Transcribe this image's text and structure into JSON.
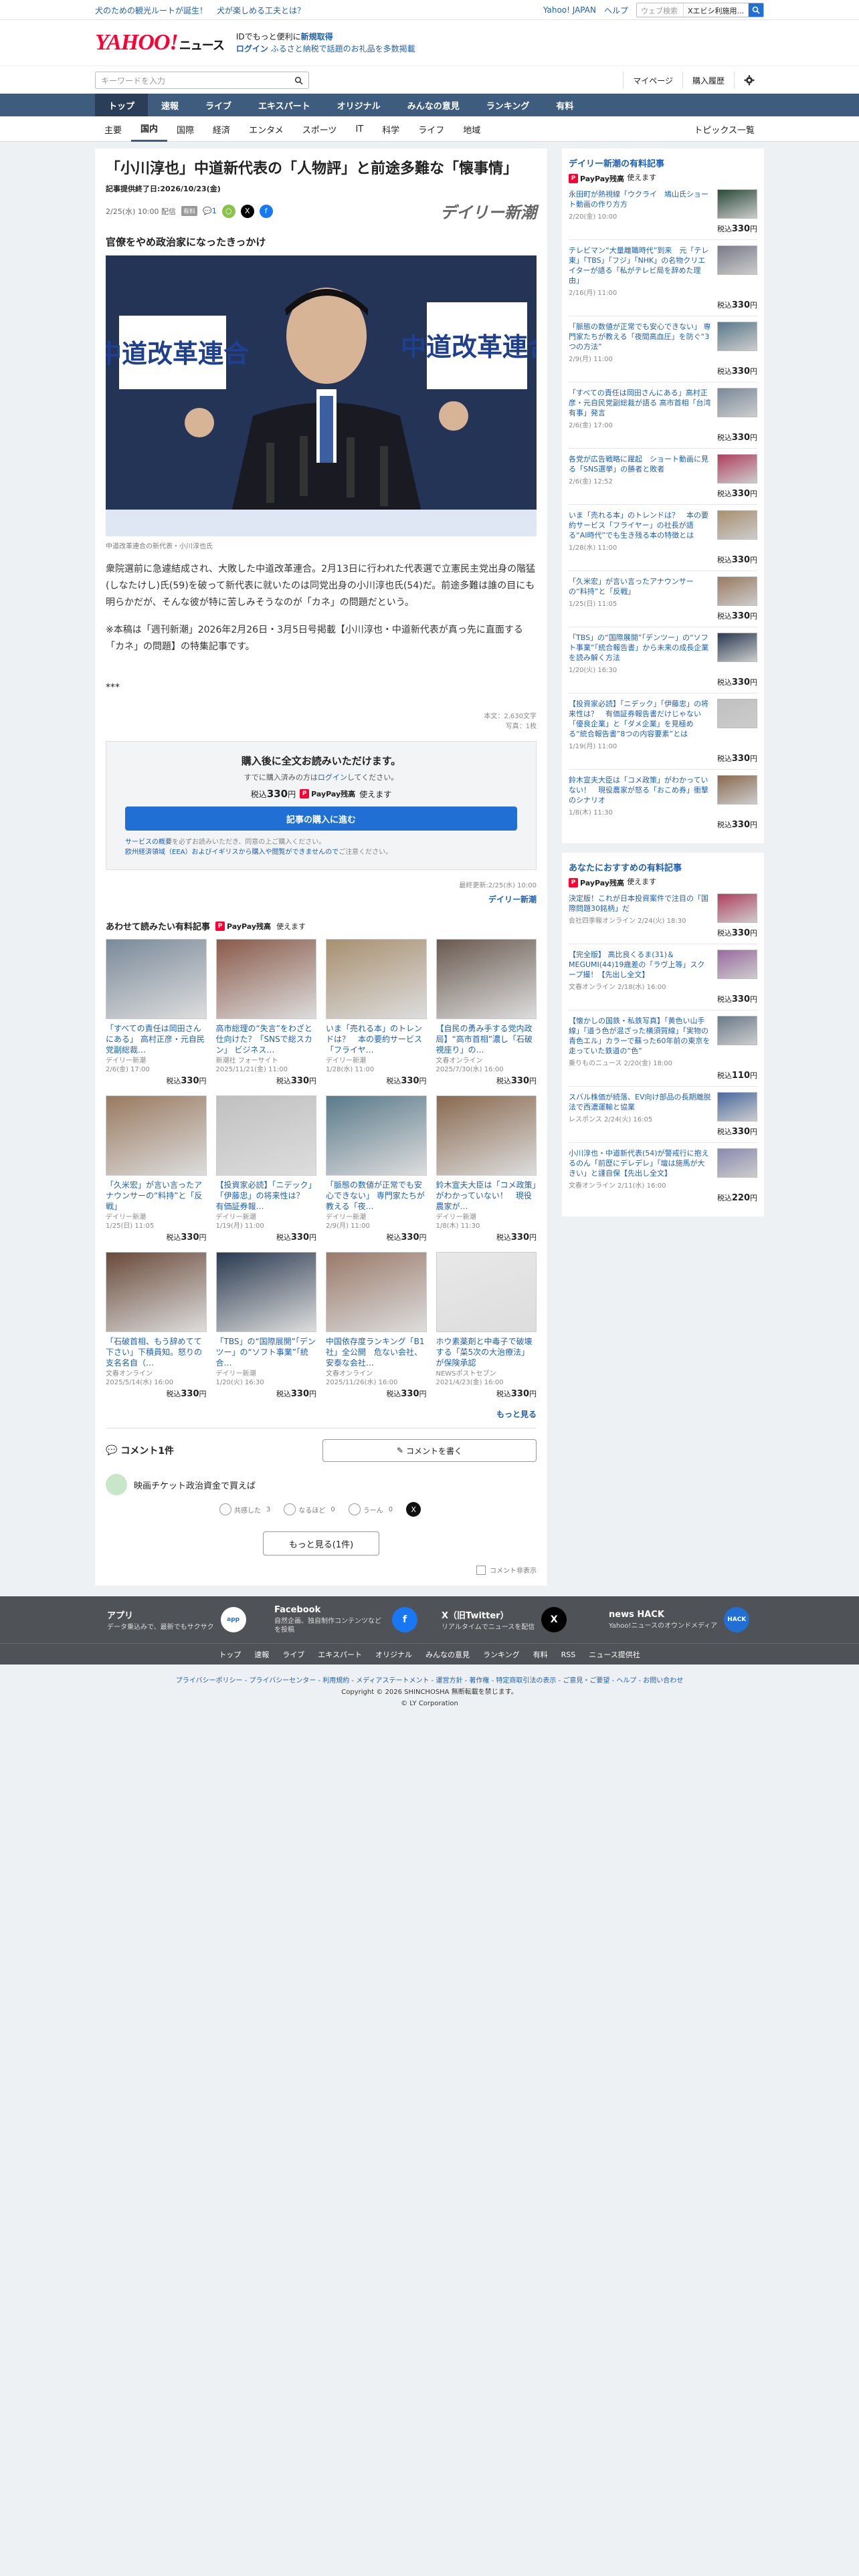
{
  "promo": {
    "link1": "犬のための観光ルートが誕生！",
    "link2": "犬が楽しめる工夫とは？"
  },
  "topright": {
    "yahoo": "Yahoo! JAPAN",
    "help": "ヘルプ",
    "search_placeholder": "ウェブ検索",
    "search_tag": "Xエビシ利施用..."
  },
  "brand": {
    "logo": "YAHOO!",
    "logo_sub": "ニュース",
    "line1_a": "IDでもっと便利に",
    "line1_b": "新規取得",
    "line2_a": "ログイン",
    "line2_b": "ふるさと納税で話題のお礼品を多数掲載"
  },
  "searchrow": {
    "placeholder": "キーワードを入力",
    "mypage": "マイページ",
    "history": "購入履歴"
  },
  "nav": [
    "トップ",
    "速報",
    "ライブ",
    "エキスパート",
    "オリジナル",
    "みんなの意見",
    "ランキング",
    "有料"
  ],
  "subnav": [
    "主要",
    "国内",
    "国際",
    "経済",
    "エンタメ",
    "スポーツ",
    "IT",
    "科学",
    "ライフ",
    "地域"
  ],
  "subnav_topics": "トピックス一覧",
  "article": {
    "title": "「小川淳也」中道新代表の「人物評」と前途多難な「懐事情」",
    "expiry": "記事提供終了日:2026/10/23(金)",
    "date": "2/25(水) 10:00 配信",
    "pill": "有料",
    "comment_count": "1",
    "publisher": "デイリー新潮",
    "subhead": "官僚をやめ政治家になったきっかけ",
    "hero_sign1": "中道改革連合",
    "hero_sign2": "中道改革連合",
    "caption": "中道改革連合の新代表・小川淳也氏",
    "para1": "衆院選前に急遽結成され、大敗した中道改革連合。2月13日に行われた代表選で立憲民主党出身の階猛(しなたけし)氏(59)を破って新代表に就いたのは同党出身の小川淳也氏(54)だ。前途多難は誰の目にも明らかだが、そんな彼が特に苦しみそうなのが「カネ」の問題だという。",
    "para2": "※本稿は「週刊新潮」2026年2月26日・3月5日号掲載【小川淳也・中道新代表が真っ先に直面する「カネ」の問題】の特集記事です。",
    "stars": "***",
    "wordcount": "本文：2,630文字",
    "photos": "写真：1枚"
  },
  "purchase": {
    "title": "購入後に全文お読みいただけます。",
    "sub_a": "すでに購入済みの方は",
    "sub_link": "ログイン",
    "sub_b": "してください。",
    "price_a": "税込",
    "price": "330",
    "price_b": "円",
    "pp_label": "PayPay残高",
    "pp_use": "使えます",
    "btn": "記事の購入に進む",
    "notice_a": "サービスの概要",
    "notice_b": "を必ずお読みいただき、同意の上ご購入ください。",
    "notice_c": "欧州経済領域（EEA）およびイギリスから購入や閲覧ができませんので",
    "notice_d": "ご注意ください。",
    "updated": "最終更新:2/25(水) 10:00",
    "pub": "デイリー新潮"
  },
  "recommend": {
    "title": "あわせて読みたい有料記事",
    "pp": "PayPay残高",
    "pp_use": "使えます",
    "more": "もっと見る",
    "items": [
      {
        "t": "「すべての責任は岡田さんにある」 高村正彦・元自民党副総裁…",
        "s": "デイリー新潮",
        "d": "2/6(金) 17:00",
        "p": "330",
        "c": "#7a8a9a"
      },
      {
        "t": "高市総理の“失言”をわざと仕向けた？「SNSで総スカン」 ビジネス…",
        "s": "新潮社 フォーサイト",
        "d": "2025/11/21(金) 11:00",
        "p": "330",
        "c": "#8a5a4a"
      },
      {
        "t": "いま「売れる本」のトレンドは？　本の要約サービス「フライヤ…",
        "s": "デイリー新潮",
        "d": "1/28(水) 11:00",
        "p": "330",
        "c": "#a89070"
      },
      {
        "t": "【自民の勇み手する党内政局】“高市首相”濃し「石破視座り」の…",
        "s": "文春オンライン",
        "d": "2025/7/30(水) 16:00",
        "p": "330",
        "c": "#6a5a50"
      },
      {
        "t": "「久米宏」が言い言ったアナウンサーの“料持”と「反戦」",
        "s": "デイリー新潮",
        "d": "1/25(日) 11:05",
        "p": "330",
        "c": "#9a7a60"
      },
      {
        "t": "【投資家必読】「ニデック」「伊藤忠」の将来性は？　有価証券報…",
        "s": "デイリー新潮",
        "d": "1/19(月) 11:00",
        "p": "330",
        "c": "#c0c0c0"
      },
      {
        "t": "「脈態の数値が正常でも安心できない」 専門家たちが教える「夜…",
        "s": "デイリー新潮",
        "d": "2/9(月) 11:00",
        "p": "330",
        "c": "#5a7a8a"
      },
      {
        "t": "鈴木宣夫大臣は「コメ政策」がわかっていない！　現役農家が…",
        "s": "デイリー新潮",
        "d": "1/8(木) 11:30",
        "p": "330",
        "c": "#8a6a50"
      },
      {
        "t": "「石破首相、もう辞めてて下さい」下積員知。怒りの支名名自（…",
        "s": "文春オンライン",
        "d": "2025/5/14(水) 16:00",
        "p": "330",
        "c": "#6a4a3a"
      },
      {
        "t": "「TBS」の“国際展開”「デンツー」の“ソフト事業”「統合…",
        "s": "デイリー新潮",
        "d": "1/20(火) 16:30",
        "p": "330",
        "c": "#2a3a50"
      },
      {
        "t": "中国依存度ランキング「B1社」全公開　危ない会社、安泰な会社…",
        "s": "文春オンライン",
        "d": "2025/11/26(水) 16:00",
        "p": "330",
        "c": "#9a7a6a"
      },
      {
        "t": "ホウ素薬剤と中毒子で破壊する「菜5次の大治療法」が保険承認",
        "s": "NEWSポストセブン",
        "d": "2021/4/23(金) 16:00",
        "p": "330",
        "c": "#e8e8e8"
      }
    ]
  },
  "comments": {
    "title": "コメント1件",
    "write": "コメントを書く",
    "text": "映画チケット政治資金で買えば",
    "r1": "共感した",
    "r1n": "3",
    "r2": "なるほど",
    "r2n": "0",
    "r3": "うーん",
    "r3n": "0",
    "more": "もっと見る(1件)",
    "hide": "コメント非表示"
  },
  "right1": {
    "title": "デイリー新潮の有料記事",
    "pp": "PayPay残高",
    "pp_use": "使えます",
    "items": [
      {
        "t": "永田町が熱視線「ウクライ　鳩山氏ショート動画の作り方方",
        "d": "2/20(金) 10:00",
        "p": "330",
        "c": "#2a4a3a"
      },
      {
        "t": "テレビマン“大量離職時代”到来　元「テレ東」「TBS」「フジ」「NHK」の名物クリエイターが語る「私がテレビ局を辞めた理由」",
        "d": "2/16(月) 11:00",
        "p": "330",
        "c": "#7a7a8a"
      },
      {
        "t": "「脈態の数値が正常でも安心できない」 専門家たちが教える「夜間高血圧」を防ぐ“3つの方法”",
        "d": "2/9(月) 11:00",
        "p": "330",
        "c": "#5a7a8a"
      },
      {
        "t": "「すべての責任は岡田さんにある」高村正彦・元自民党副総裁が語る 高市首相「台湾有事」発言",
        "d": "2/6(金) 17:00",
        "p": "330",
        "c": "#7a8a9a"
      },
      {
        "t": "各党が広告戦略に躍起　ショート動画に見る「SNS選挙」の勝者と敗者",
        "d": "2/6(金) 12:52",
        "p": "330",
        "c": "#b04060"
      },
      {
        "t": "いま「売れる本」のトレンドは？　本の要約サービス「フライヤー」の社長が語る“AI時代”でも生き残る本の特徴とは",
        "d": "1/28(水) 11:00",
        "p": "330",
        "c": "#a89070"
      },
      {
        "t": "「久米宏」が言い言ったアナウンサーの“料持”と「反戦」",
        "d": "1/25(日) 11:05",
        "p": "330",
        "c": "#9a7a60"
      },
      {
        "t": "「TBS」の“国際展開”「デンツー」の“ソフト事業”「統合報告書」から未来の成長企業を読み解く方法",
        "d": "1/20(火) 16:30",
        "p": "330",
        "c": "#2a3a50"
      },
      {
        "t": "【投資家必読】「ニデック」「伊藤忠」の将来性は？　有価証券報告書だけじゃない「優良企業」と「ダメ企業」を見極める“統合報告書”8つの内容要素”とは",
        "d": "1/19(月) 11:00",
        "p": "330",
        "c": "#c0c0c0"
      },
      {
        "t": "鈴木宣夫大臣は「コメ政策」がわかっていない！　現役農家が怒る「おこめ券」衝撃のシナリオ",
        "d": "1/8(木) 11:30",
        "p": "330",
        "c": "#8a6a50"
      }
    ]
  },
  "right2": {
    "title": "あなたにおすすめの有料記事",
    "pp": "PayPay残高",
    "pp_use": "使えます",
    "items": [
      {
        "t": "決定版！これが日本投資案件で注目の「国際問題30銘柄」だ",
        "d": "会社四季報オンライン 2/24(火) 18:30",
        "p": "330",
        "c": "#b04060"
      },
      {
        "t": "【完全版】 高比良くるま(31)＆MEGUMI(44)19歳差の「ラヴ上等」スクープ撮！【先出し全文】",
        "d": "文春オンライン 2/18(水) 16:00",
        "p": "330",
        "c": "#9a6aa0"
      },
      {
        "t": "【懐かしの国鉄・私鉄写真】「黄色い山手線」「道う色が混ざった横須賀線」「実物の青色エル」カラーで蘇った60年前の東京を走っていた鉄道の“色”",
        "d": "乗りものニュース 2/20(金) 18:00",
        "p": "110",
        "c": "#6a7a8a"
      },
      {
        "t": "スバル株価が続落、EV向け部品の長期離脱法で西濃運輸と協業",
        "d": "レスポンス 2/24(火) 16:05",
        "p": "330",
        "c": "#4a6aa0"
      },
      {
        "t": "小川淳也・中道新代表(54)が警戒行に抱えるのん「前歴にデレデレ」「壇は施馬が大きい」と謹自保【先出し全文】",
        "d": "文春オンライン 2/11(水) 16:00",
        "p": "220",
        "c": "#8a8ab0"
      }
    ]
  },
  "footer_boxes": [
    {
      "t": "アプリ",
      "d": "データ乗込みで、最新でもサクサク",
      "ic": "app"
    },
    {
      "t": "Facebook",
      "d": "自然企画、独自制作コンテンツなどを投稿",
      "ic": "f"
    },
    {
      "t": "X（旧Twitter）",
      "d": "リアルタイムでニュースを配信",
      "ic": "X"
    },
    {
      "t": "news HACK",
      "d": "Yahoo!ニュースのオウンドメディア",
      "ic": "HACK"
    }
  ],
  "footer_links": [
    "トップ",
    "速報",
    "ライブ",
    "エキスパート",
    "オリジナル",
    "みんなの意見",
    "ランキング",
    "有料",
    "RSS",
    "ニュース提供社"
  ],
  "legal": {
    "links": "プライバシーポリシー - プライバシーセンター - 利用規約 - メディアステートメント - 運営方針 - 著作権 - 特定商取引法の表示 - ご意見・ご要望 - ヘルプ - お問い合わせ",
    "copy1": "Copyright © 2026 SHINCHOSHA 無断転載を禁じます。",
    "copy2": "© LY Corporation"
  }
}
